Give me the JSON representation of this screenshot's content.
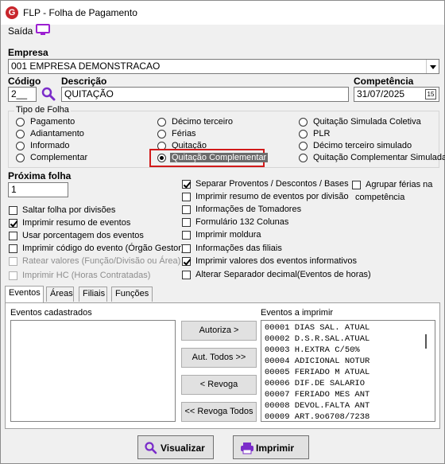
{
  "window": {
    "title": "FLP - Folha de Pagamento",
    "logo_letter": "G"
  },
  "menu": {
    "saida": "Saída"
  },
  "empresa": {
    "label": "Empresa",
    "value": "001 EMPRESA DEMONSTRACAO"
  },
  "codigo": {
    "label": "Código",
    "value": "2__"
  },
  "descricao": {
    "label": "Descrição",
    "value": "QUITAÇÃO"
  },
  "competencia": {
    "label": "Competência",
    "value": "31/07/2025",
    "calendar_day": "15"
  },
  "tipo_folha": {
    "title": "Tipo de Folha",
    "col1": [
      "Pagamento",
      "Adiantamento",
      "Informado",
      "Complementar"
    ],
    "col2": [
      "Décimo terceiro",
      "Férias",
      "Quitação",
      "Quitação Complementar"
    ],
    "col3": [
      "Quitação Simulada Coletiva",
      "PLR",
      "Décimo terceiro simulado",
      "Quitação Complementar Simulada"
    ],
    "selected": "Quitação Complementar"
  },
  "proxima_folha": {
    "label": "Próxima folha",
    "value": "1"
  },
  "options_left": [
    {
      "label": "Saltar folha por divisões",
      "checked": false,
      "disabled": false
    },
    {
      "label": "Imprimir resumo de eventos",
      "checked": true,
      "disabled": false
    },
    {
      "label": "Usar porcentagem dos eventos",
      "checked": false,
      "disabled": false
    },
    {
      "label": "Imprimir código do evento (Órgão Gestor)",
      "checked": false,
      "disabled": false
    },
    {
      "label": "Ratear valores (Função/Divisão ou Área)",
      "checked": false,
      "disabled": true
    },
    {
      "label": "Imprimir HC (Horas Contratadas)",
      "checked": false,
      "disabled": true
    }
  ],
  "options_mid": [
    {
      "label": "Separar Proventos / Descontos / Bases",
      "checked": true
    },
    {
      "label": "Imprimir resumo de eventos por divisão",
      "checked": false
    },
    {
      "label": "Informações de Tomadores",
      "checked": false
    },
    {
      "label": "Formulário 132 Colunas",
      "checked": false
    },
    {
      "label": "Imprimir moldura",
      "checked": false
    },
    {
      "label": "Informações das filiais",
      "checked": false
    },
    {
      "label": "Imprimir valores dos eventos informativos",
      "checked": true
    },
    {
      "label": "Alterar Separador decimal(Eventos de horas)",
      "checked": false
    }
  ],
  "agrupar": {
    "label_line1": "Agrupar férias na",
    "label_line2": "competência",
    "checked": false
  },
  "tabs": [
    "Eventos",
    "Áreas",
    "Filiais",
    "Funções"
  ],
  "eventos_cadastrados": {
    "label": "Eventos cadastrados"
  },
  "eventos_imprimir": {
    "label": "Eventos a imprimir",
    "items": [
      "00001 DIAS SAL. ATUAL",
      "00002 D.S.R.SAL.ATUAL",
      "00003 H.EXTRA C/50%",
      "00004 ADICIONAL NOTUR",
      "00005 FERIADO M ATUAL",
      "00006 DIF.DE SALARIO",
      "00007 FERIADO MES ANT",
      "00008 DEVOL.FALTA ANT",
      "00009 ART.9o6708/7238"
    ]
  },
  "transfer_buttons": {
    "autoriza": "Autoriza >",
    "aut_todos": "Aut. Todos >>",
    "revoga": "< Revoga",
    "revoga_todos": "<< Revoga Todos"
  },
  "footer": {
    "visualizar": "Visualizar",
    "imprimir": "Imprimir"
  },
  "colors": {
    "accent": "#c8262c",
    "highlight_border": "#d11a1a",
    "selected_bg": "#6b6b6b",
    "icon_purple": "#9c1fd1"
  }
}
